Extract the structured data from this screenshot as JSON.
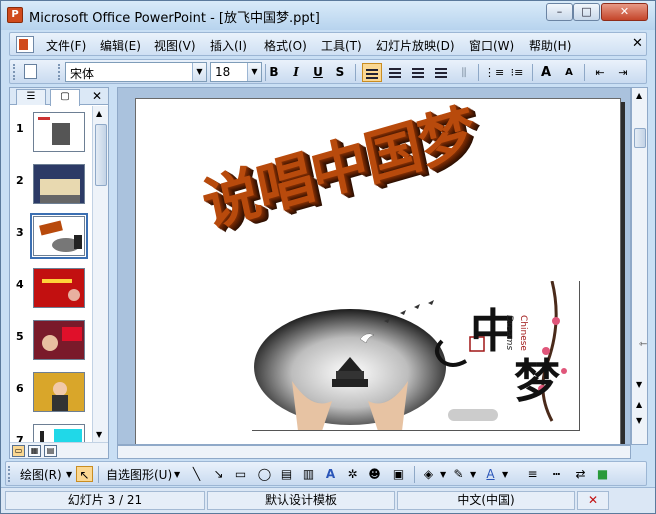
{
  "window": {
    "title": "Microsoft Office PowerPoint - [放飞中国梦.ppt]",
    "min_symbol": "–",
    "max_symbol": "□",
    "close_symbol": "✕"
  },
  "menu": {
    "items": [
      "文件(F)",
      "编辑(E)",
      "视图(V)",
      "插入(I)",
      "格式(O)",
      "工具(T)",
      "幻灯片放映(D)",
      "窗口(W)",
      "帮助(H)"
    ],
    "close_symbol": "✕"
  },
  "toolbar": {
    "font_name": "宋体",
    "font_size": "18",
    "bold": "B",
    "italic": "I",
    "underline": "U",
    "shadow": "S",
    "grow_font": "A",
    "shrink_font": "A"
  },
  "outline_pane": {
    "tab_outline_symbol": "☰",
    "tab_slides_symbol": "▢",
    "close_symbol": "✕",
    "slides": [
      {
        "number": "1"
      },
      {
        "number": "2"
      },
      {
        "number": "3"
      },
      {
        "number": "4"
      },
      {
        "number": "5"
      },
      {
        "number": "6"
      },
      {
        "number": "7"
      }
    ]
  },
  "slide": {
    "title": "说唱中国梦",
    "art_char_1": "中",
    "art_char_2": "梦",
    "art_dreams": "Dreams",
    "art_chinese": "Chinese"
  },
  "drawing_toolbar": {
    "draw_label": "绘图(R)",
    "autoshapes_label": "自选图形(U)"
  },
  "status": {
    "slide_info": "幻灯片 3 / 21",
    "design": "默认设计模板",
    "language": "中文(中国)"
  },
  "colors": {
    "accent_active": "#fbd892",
    "title_orange": "#b84a0c",
    "close_red": "#c4452a"
  }
}
